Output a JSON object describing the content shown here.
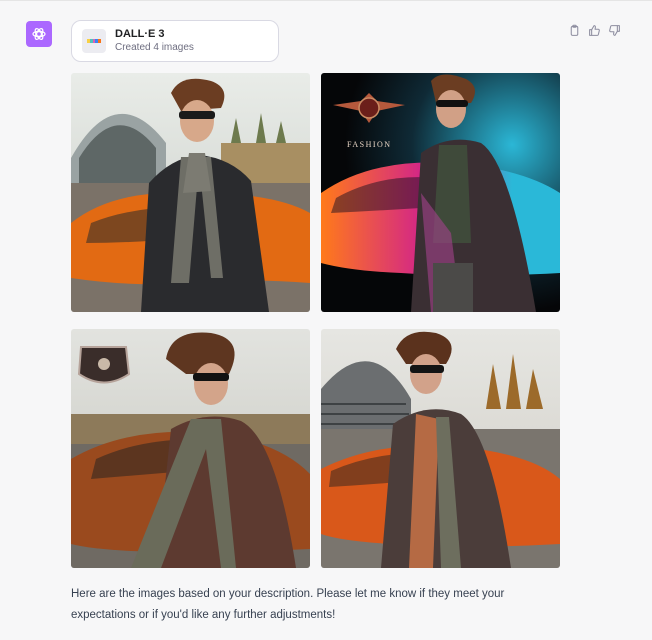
{
  "assistant": {
    "avatar_icon": "openai-logo-icon",
    "avatar_color": "#ab68ff"
  },
  "plugin": {
    "title": "DALL·E 3",
    "subtitle": "Created 4 images",
    "icon": "dalle-icon",
    "stripe_colors": [
      "#f7d046",
      "#4cc4bd",
      "#e05fb2",
      "#3b82f6",
      "#f97316"
    ]
  },
  "actions": {
    "copy_icon": "clipboard-icon",
    "like_icon": "thumbs-up-icon",
    "dislike_icon": "thumbs-down-icon"
  },
  "images": [
    {
      "id": "generated-image-1",
      "scene": "man in sunglasses and scarf beside orange sports car, hangar background"
    },
    {
      "id": "generated-image-2",
      "scene": "man in long coat with winged emblem and colorful sports car on dark background",
      "overlay_text": "FASHION"
    },
    {
      "id": "generated-image-3",
      "scene": "man with windswept hair and scarf beside copper sports car, shield emblem"
    },
    {
      "id": "generated-image-4",
      "scene": "man in long coat beside orange sports car at stadium"
    }
  ],
  "message": {
    "text": "Here are the images based on your description. Please let me know if they meet your expectations or if you'd like any further adjustments!"
  }
}
